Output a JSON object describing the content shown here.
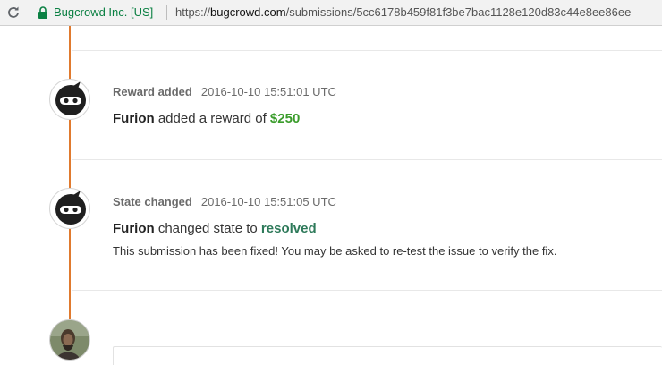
{
  "browser": {
    "origin_label": "Bugcrowd Inc. [US]",
    "url_scheme": "https://",
    "url_host": "bugcrowd.com",
    "url_path": "/submissions/5cc6178b459f81f3be7bac1128e120d83c44e8ee86ee",
    "icons": {
      "reload": "reload-icon",
      "lock": "lock-icon"
    },
    "colors": {
      "secure": "#0b8043"
    }
  },
  "timeline": {
    "accent_color": "#e07a2e",
    "events": [
      {
        "type_label": "Reward added",
        "timestamp": "2016-10-10 15:51:01 UTC",
        "actor": "Furion",
        "action_text": " added a reward of ",
        "value": "$250",
        "value_color": "#3a9c2b",
        "avatar": "ninja-avatar"
      },
      {
        "type_label": "State changed",
        "timestamp": "2016-10-10 15:51:05 UTC",
        "actor": "Furion",
        "action_text": " changed state to ",
        "value": "resolved",
        "value_color": "#2e7a5a",
        "note": "This submission has been fixed! You may be asked to re-test the issue to verify the fix.",
        "avatar": "ninja-avatar"
      }
    ],
    "current_user_avatar": "user-photo-avatar"
  }
}
